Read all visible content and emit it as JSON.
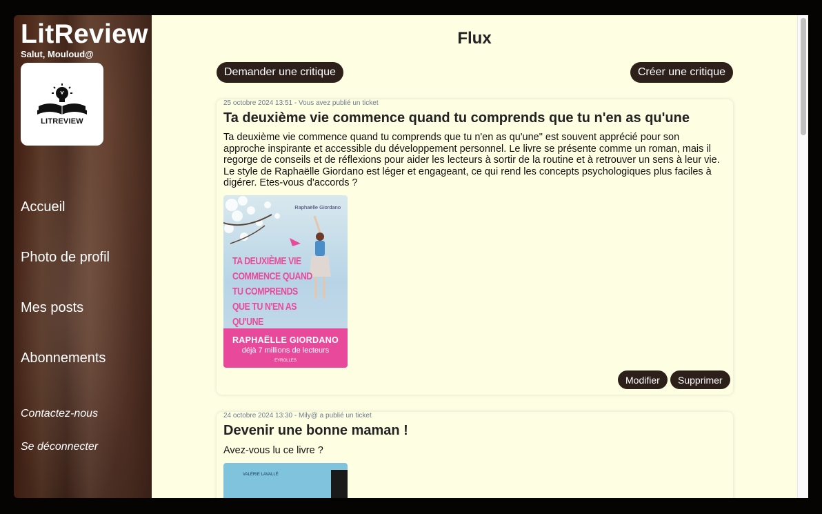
{
  "sidebar": {
    "brand": "LitReview",
    "greeting": "Salut, Mouloud@",
    "logo_text": "LITREVIEW",
    "nav": [
      "Accueil",
      "Photo de profil",
      "Mes posts",
      "Abonnements"
    ],
    "secondary": [
      "Contactez-nous",
      "Se déconnecter"
    ]
  },
  "main": {
    "title": "Flux",
    "request_button": "Demander une critique",
    "create_button": "Créer une critique",
    "posts": [
      {
        "meta": "25 octobre 2024 13:51 - Vous avez publié un ticket",
        "title": "Ta deuxième vie commence quand tu comprends que tu n'en as qu'une",
        "body": "Ta deuxième vie commence quand tu comprends que tu n'en as qu'une\" est souvent apprécié pour son approche inspirante et accessible du développement personnel. Le livre se présente comme un roman, mais il regorge de conseils et de réflexions pour aider les lecteurs à sortir de la routine et à retrouver un sens à leur vie. Le style de Raphaëlle Giordano est léger et engageant, ce qui rend les concepts psychologiques plus faciles à digérer. Etes-vous d'accords ?",
        "cover": {
          "author_top": "Raphaëlle Giordano",
          "title_lines": [
            "TA DEUXIÈME VIE",
            "COMMENCE QUAND",
            "TU COMPRENDS",
            "QUE TU N'EN AS",
            "QU'UNE"
          ],
          "author_band": "RAPHAËLLE GIORDANO",
          "readers": "déjà 7 millions de lecteurs",
          "publisher": "EYROLLES"
        },
        "edit_label": "Modifier",
        "delete_label": "Supprimer"
      },
      {
        "meta": "24 octobre 2024 13:30 - Mily@ a publié un ticket",
        "title": "Devenir une bonne maman !",
        "body": "Avez-vous lu ce livre ?",
        "cover": {
          "author_top": "VALÉRIE LAVALLÉ"
        }
      }
    ]
  },
  "colors": {
    "main_bg": "#fefee3",
    "button_bg": "#2d1f1a",
    "cover_pink": "#e9499b"
  }
}
